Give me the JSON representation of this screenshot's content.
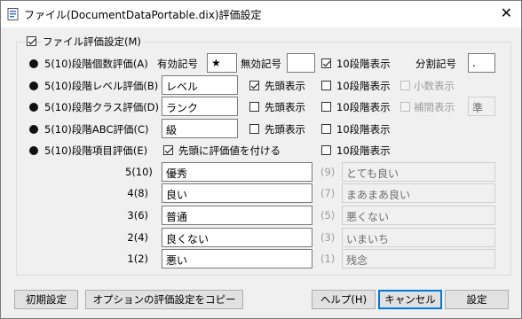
{
  "window": {
    "title": "ファイル(DocumentDataPortable.dix)評価設定",
    "close_glyph": "✕"
  },
  "group": {
    "checkbox_label": "ファイル評価設定(M)",
    "checked": true
  },
  "rows": [
    {
      "label": "5(10)段階個数評価(A)",
      "valid_label": "有効記号",
      "valid_value": "★",
      "invalid_label": "無効記号",
      "invalid_value": "",
      "ten_label": "10段階表示",
      "ten_checked": true,
      "split_label": "分割記号",
      "split_value": "."
    },
    {
      "label": "5(10)段階レベル評価(B)",
      "field_value": "レベル",
      "prefix_label": "先頭表示",
      "prefix_checked": true,
      "ten_label": "10段階表示",
      "ten_checked": false,
      "extra_label": "小数表示"
    },
    {
      "label": "5(10)段階クラス評価(D)",
      "field_value": "ランク",
      "prefix_label": "先頭表示",
      "prefix_checked": false,
      "ten_label": "10段階表示",
      "ten_checked": false,
      "extra_label": "補間表示",
      "extra_value": "準"
    },
    {
      "label": "5(10)段階ABC評価(C)",
      "field_value": "級",
      "prefix_label": "先頭表示",
      "prefix_checked": false,
      "ten_label": "10段階表示",
      "ten_checked": false
    },
    {
      "label": "5(10)段階項目評価(E)",
      "prefix_label": "先頭に評価値を付ける",
      "prefix_checked": true,
      "ten_label": "10段階表示",
      "ten_checked": false
    }
  ],
  "items": [
    {
      "level": "5(10)",
      "value": "優秀",
      "alt_level": "(9)",
      "alt_value": "とても良い"
    },
    {
      "level": "4(8)",
      "value": "良い",
      "alt_level": "(7)",
      "alt_value": "まあまあ良い"
    },
    {
      "level": "3(6)",
      "value": "普通",
      "alt_level": "(5)",
      "alt_value": "悪くない"
    },
    {
      "level": "2(4)",
      "value": "良くない",
      "alt_level": "(3)",
      "alt_value": "いまいち"
    },
    {
      "level": "1(2)",
      "value": "悪い",
      "alt_level": "(1)",
      "alt_value": "残念"
    }
  ],
  "buttons": {
    "init": "初期設定",
    "copy": "オプションの評価設定をコピー",
    "help": "ヘルプ(H)",
    "cancel": "キャンセル",
    "ok": "設定"
  }
}
